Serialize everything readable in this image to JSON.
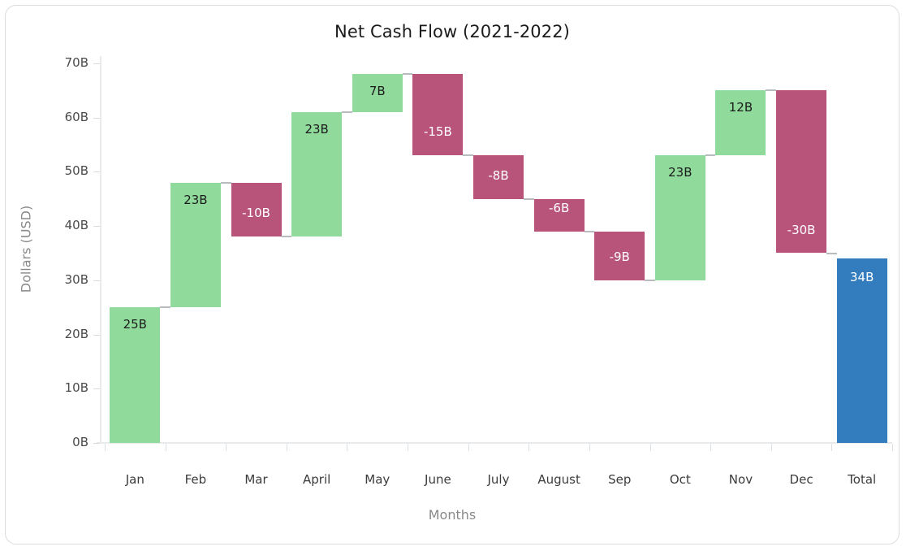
{
  "chart": {
    "title": "Net Cash Flow (2021-2022)",
    "xlabel": "Months",
    "ylabel": "Dollars (USD)"
  },
  "chart_data": {
    "type": "bar",
    "chart_subtype": "waterfall",
    "title": "Net Cash Flow (2021-2022)",
    "xlabel": "Months",
    "ylabel": "Dollars (USD)",
    "categories": [
      "Jan",
      "Feb",
      "Mar",
      "April",
      "May",
      "June",
      "July",
      "August",
      "Sep",
      "Oct",
      "Nov",
      "Dec",
      "Total"
    ],
    "values": [
      25,
      23,
      -10,
      23,
      7,
      -15,
      -8,
      -6,
      -9,
      23,
      12,
      -30,
      34
    ],
    "data_labels": [
      "25B",
      "23B",
      "-10B",
      "23B",
      "7B",
      "-15B",
      "-8B",
      "-6B",
      "-9B",
      "23B",
      "12B",
      "-30B",
      "34B"
    ],
    "measure": [
      "relative",
      "relative",
      "relative",
      "relative",
      "relative",
      "relative",
      "relative",
      "relative",
      "relative",
      "relative",
      "relative",
      "relative",
      "total"
    ],
    "cumulative_start": [
      0,
      25,
      48,
      38,
      61,
      68,
      53,
      45,
      39,
      30,
      53,
      65,
      0
    ],
    "cumulative_end": [
      25,
      48,
      38,
      61,
      68,
      53,
      45,
      39,
      30,
      53,
      65,
      35,
      34
    ],
    "ytick_labels": [
      "0B",
      "10B",
      "20B",
      "30B",
      "40B",
      "50B",
      "60B",
      "70B"
    ],
    "ytick_values": [
      0,
      10,
      20,
      30,
      40,
      50,
      60,
      70
    ],
    "ylim": [
      0,
      70
    ],
    "grid": false,
    "legend": "none",
    "colors": {
      "increase": "#90DB9C",
      "decrease": "#B8547A",
      "total": "#337CBE",
      "connector": "#b9bcbf",
      "axis": "#e8eaec",
      "label_dark": "#1b1b1b",
      "label_light": "#ffffff"
    }
  }
}
